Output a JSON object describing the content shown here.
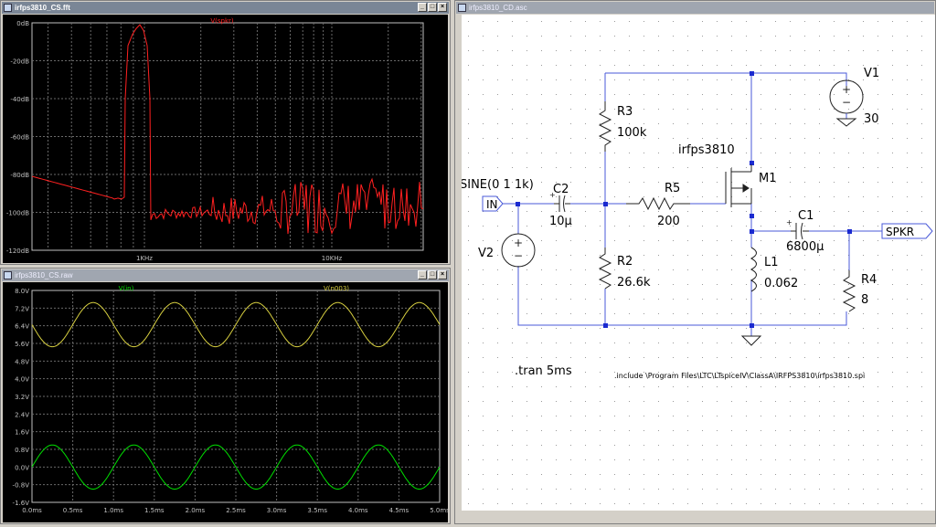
{
  "fft_window": {
    "title": "irfps3810_CS.fft",
    "trace_label": "V(spkr)",
    "trace_color": "#ff2020",
    "y_ticks": [
      "0dB",
      "-20dB",
      "-40dB",
      "-60dB",
      "-80dB",
      "-100dB",
      "-120dB"
    ],
    "x_ticks": [
      "1KHz",
      "10KHz"
    ]
  },
  "raw_window": {
    "title": "irfps3810_CS.raw",
    "trace1_label": "V(in)",
    "trace1_color": "#00e000",
    "trace2_label": "V(n003)",
    "trace2_color": "#d8d040",
    "y_ticks": [
      "8.0V",
      "7.2V",
      "6.4V",
      "5.6V",
      "4.8V",
      "4.0V",
      "3.2V",
      "2.4V",
      "1.6V",
      "0.8V",
      "0.0V",
      "-0.8V",
      "-1.6V"
    ],
    "x_ticks": [
      "0.0ms",
      "0.5ms",
      "1.0ms",
      "1.5ms",
      "2.0ms",
      "2.5ms",
      "3.0ms",
      "3.5ms",
      "4.0ms",
      "4.5ms",
      "5.0ms"
    ]
  },
  "schematic_window": {
    "title": "irfps3810_CD.asc",
    "labels": {
      "v1": "V1",
      "v1_value": "30",
      "r3": "R3",
      "r3_value": "100k",
      "mosfet_model": "irfps3810",
      "m1": "M1",
      "source": "SINE(0 1 1k)",
      "in_port": "IN",
      "c2": "C2",
      "c2_value": "10µ",
      "r5": "R5",
      "r5_value": "200",
      "c1": "C1",
      "c1_value": "6800µ",
      "spkr_port": "SPKR",
      "v2": "V2",
      "r2": "R2",
      "r2_value": "26.6k",
      "l1": "L1",
      "l1_value": "0.062",
      "r4": "R4",
      "r4_value": "8",
      "tran": ".tran 5ms",
      "include": ".include \\Program Files\\LTC\\LTspiceIV\\ClassA\\IRFPS3810\\irfps3810.spi"
    },
    "wire_color": "#4a5ad8",
    "component_color": "#202020",
    "text_color": "#000000"
  }
}
